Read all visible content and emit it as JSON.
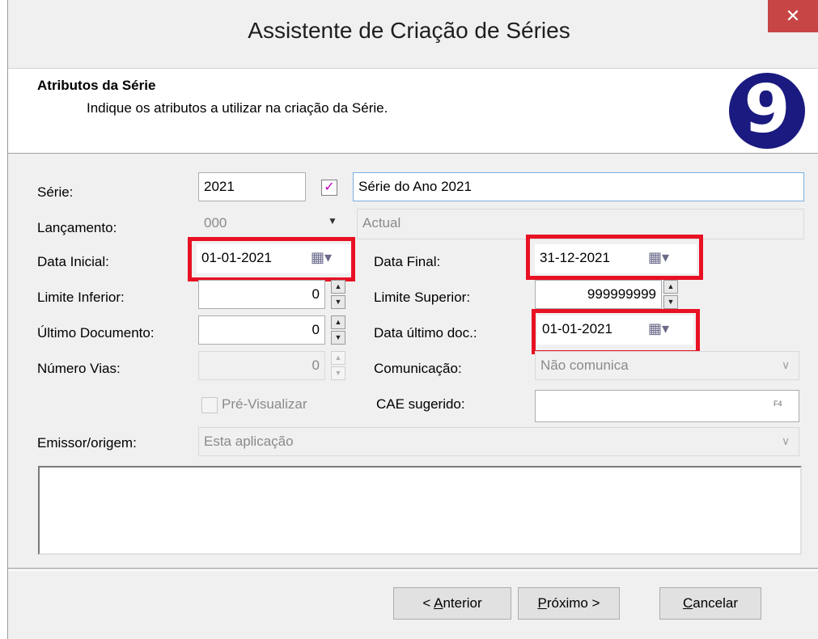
{
  "window": {
    "title": "Assistente de Criação de Séries",
    "close_symbol": "✕"
  },
  "header": {
    "title": "Atributos da Série",
    "subtitle": "Indique os atributos a utilizar na criação da Série.",
    "logo_text": "9"
  },
  "form": {
    "serie": {
      "label": "Série:",
      "value": "2021",
      "checked": true,
      "description": "Série do Ano 2021"
    },
    "lancamento": {
      "label": "Lançamento:",
      "value": "000",
      "description": "Actual"
    },
    "data_inicial": {
      "label": "Data Inicial:",
      "value": "01-01-2021"
    },
    "data_final": {
      "label": "Data Final:",
      "value": "31-12-2021"
    },
    "limite_inferior": {
      "label": "Limite Inferior:",
      "value": "0"
    },
    "limite_superior": {
      "label": "Limite Superior:",
      "value": "999999999"
    },
    "ultimo_documento": {
      "label": "Último Documento:",
      "value": "0"
    },
    "data_ultimo_doc": {
      "label": "Data último doc.:",
      "value": "01-01-2021"
    },
    "numero_vias": {
      "label": "Número Vias:",
      "value": "0"
    },
    "comunicacao": {
      "label": "Comunicação:",
      "value": "Não comunica"
    },
    "pre_visualizar": {
      "label": "Pré-Visualizar",
      "checked": false
    },
    "cae_sugerido": {
      "label": "CAE sugerido:",
      "value": "",
      "button": "F4"
    },
    "emissor": {
      "label": "Emissor/origem:",
      "value": "Esta aplicação"
    }
  },
  "buttons": {
    "anterior_prefix": "< ",
    "anterior_mnemonic": "A",
    "anterior_rest": "nterior",
    "proximo_mnemonic": "P",
    "proximo_rest": "róximo >",
    "cancelar_mnemonic": "C",
    "cancelar_rest": "ancelar"
  },
  "colors": {
    "highlight": "#e81123",
    "logo": "#1a1a80",
    "close": "#c74545"
  }
}
